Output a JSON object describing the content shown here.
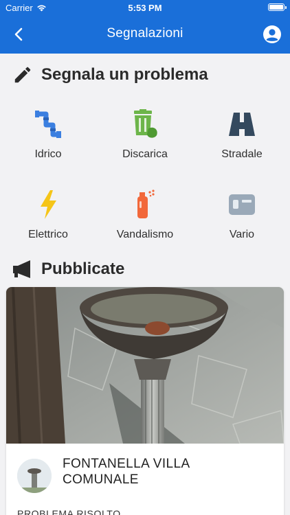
{
  "status_bar": {
    "carrier": "Carrier",
    "time": "5:53 PM"
  },
  "navbar": {
    "title": "Segnalazioni"
  },
  "report": {
    "heading": "Segnala un problema",
    "categories": [
      {
        "label": "Idrico",
        "icon": "pipe-icon",
        "color": "#3b7fe0"
      },
      {
        "label": "Discarica",
        "icon": "trash-icon",
        "color": "#6db54a"
      },
      {
        "label": "Stradale",
        "icon": "road-icon",
        "color": "#34495e"
      },
      {
        "label": "Elettrico",
        "icon": "lightning-icon",
        "color": "#f5c518"
      },
      {
        "label": "Vandalismo",
        "icon": "spray-can-icon",
        "color": "#f2683a"
      },
      {
        "label": "Vario",
        "icon": "misc-card-icon",
        "color": "#9aa9b8"
      }
    ]
  },
  "published": {
    "heading": "Pubblicate",
    "items": [
      {
        "title": "FONTANELLA VILLA COMUNALE",
        "status": "PROBLEMA RISOLTO"
      }
    ]
  },
  "colors": {
    "header": "#1a6fd9",
    "background": "#f2f2f4"
  }
}
